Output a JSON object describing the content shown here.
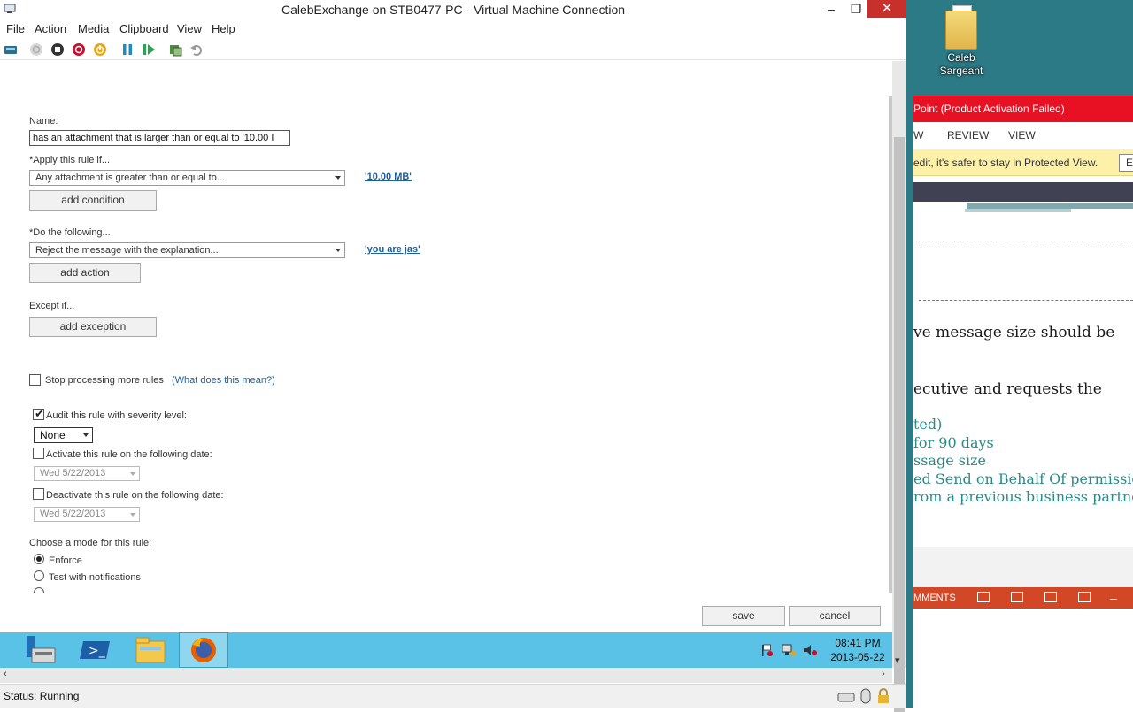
{
  "window": {
    "title": "CalebExchange on STB0477-PC - Virtual Machine Connection",
    "minimize": "–",
    "restore": "❐",
    "close": "✕"
  },
  "menu": [
    "File",
    "Action",
    "Media",
    "Clipboard",
    "View",
    "Help"
  ],
  "toolbar_icons": [
    "ctrl-alt-del-icon",
    "start-icon",
    "turn-off-icon",
    "shut-down-icon",
    "save-state-icon",
    "pause-icon",
    "resume-icon",
    "checkpoint-icon",
    "revert-icon"
  ],
  "rule": {
    "name_label": "Name:",
    "name_value": "has an attachment that is larger than or equal to '10.00 I",
    "apply_label": "*Apply this rule if...",
    "apply_select": "Any attachment is greater than or equal to...",
    "apply_link": "'10.00 MB'",
    "add_condition": "add condition",
    "do_label": "*Do the following...",
    "do_select": "Reject the message with the explanation...",
    "do_link": "'you are jas'",
    "add_action": "add action",
    "except_label": "Except if...",
    "add_exception": "add exception",
    "stop_processing": "Stop processing more rules",
    "what_does": "(What does this mean?)",
    "audit_label": "Audit this rule with severity level:",
    "audit_checked": true,
    "severity": "None",
    "activate_label": "Activate this rule on the following date:",
    "activate_date": "Wed 5/22/2013",
    "deactivate_label": "Deactivate this rule on the following date:",
    "deactivate_date": "Wed 5/22/2013",
    "mode_label": "Choose a mode for this rule:",
    "mode_enforce": "Enforce",
    "mode_test": "Test with notifications",
    "save": "save",
    "cancel": "cancel"
  },
  "taskbar": {
    "apps": [
      "server-manager-icon",
      "powershell-icon",
      "file-explorer-icon",
      "firefox-icon"
    ],
    "time": "08:41 PM",
    "date": "2013-05-22"
  },
  "status": "Status: Running",
  "host": {
    "folder_label": "Caleb Sargeant",
    "ppt_title": "Point (Product Activation Failed)",
    "ribbon_w": "W",
    "ribbon_review": "REVIEW",
    "ribbon_view": "VIEW",
    "protected_text": "edit, it's safer to stay in Protected View.",
    "enable_btn": "E",
    "slide_lines": [
      "ve message size should be",
      "ecutive and requests the",
      "ted)",
      "for 90 days",
      "ssage size",
      "ed Send on Behalf Of permissions",
      "rom a previous business partner:"
    ],
    "status_comments": "MMENTS"
  }
}
